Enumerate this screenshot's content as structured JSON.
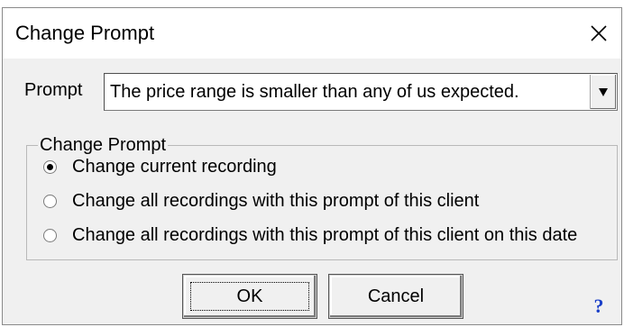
{
  "window": {
    "title": "Change Prompt"
  },
  "prompt": {
    "label": "Prompt",
    "value": "The price range is smaller than any of us expected."
  },
  "group": {
    "legend": "Change Prompt",
    "options": [
      {
        "label": "Change current recording",
        "checked": true
      },
      {
        "label": "Change all recordings with this prompt of this client",
        "checked": false
      },
      {
        "label": "Change all recordings with this prompt of this client on this date",
        "checked": false
      }
    ]
  },
  "buttons": {
    "ok": "OK",
    "cancel": "Cancel",
    "help": "?"
  },
  "icons": {
    "close": "close-icon",
    "dropdown": "dropdown-arrow-icon",
    "help": "help-icon"
  }
}
